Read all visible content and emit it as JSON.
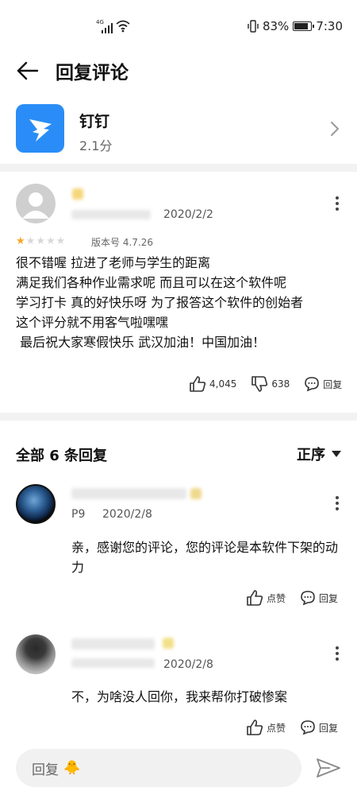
{
  "status": {
    "network": "4G",
    "battery": "83%",
    "battery_level": 0.83,
    "time": "7:30"
  },
  "header": {
    "title": "回复评论"
  },
  "app": {
    "name": "钉钉",
    "score": "2.1分",
    "icon": "dingtalk-logo",
    "accent": "#2a8df7"
  },
  "comment": {
    "date": "2020/2/2",
    "rating": 1,
    "rating_max": 5,
    "version": "版本号 4.7.26",
    "text": "很不错喔 拉进了老师与学生的距离\n满足我们各种作业需求呢 而且可以在这个软件呢\n学习打卡 真的好快乐呀 为了报答这个软件的创始者\n这个评分就不用客气啦嘿嘿\n 最后祝大家寒假快乐 武汉加油！中国加油！",
    "likes": "4,045",
    "dislikes": "638",
    "reply_label": "回复"
  },
  "replies": {
    "header": "全部 6 条回复",
    "sort_label": "正序",
    "items": [
      {
        "tag": "P9",
        "date": "2020/2/8",
        "text": "亲，感谢您的评论，您的评论是本软件下架的动力",
        "like_label": "点赞",
        "reply_label": "回复"
      },
      {
        "tag": "",
        "date": "2020/2/8",
        "text": "不，为啥没人回你，我来帮你打破惨案",
        "like_label": "点赞",
        "reply_label": "回复"
      }
    ]
  },
  "footer": {
    "input_placeholder": "回复",
    "emoji": "🐥"
  }
}
